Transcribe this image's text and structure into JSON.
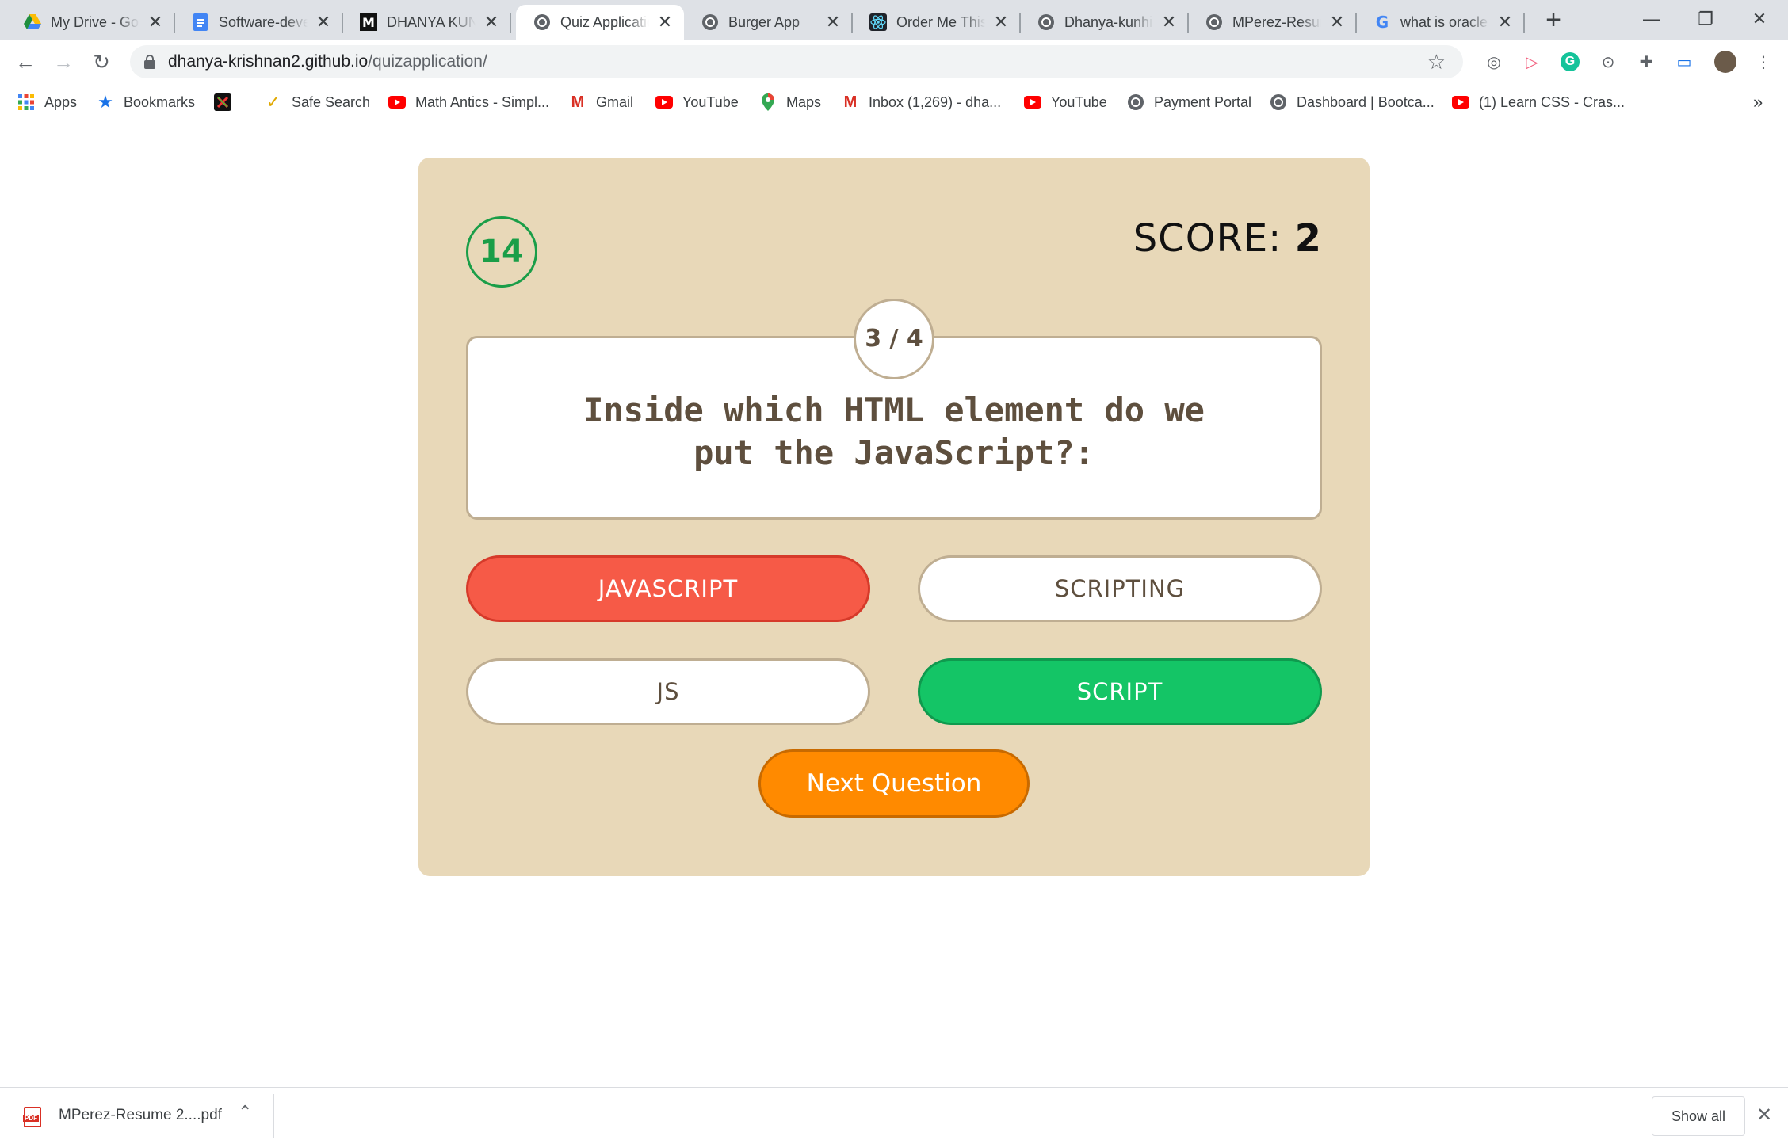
{
  "browser": {
    "tabs": [
      {
        "title": "My Drive - Google Drive",
        "favicon": "google-drive-icon"
      },
      {
        "title": "Software-developer",
        "favicon": "google-docs-icon"
      },
      {
        "title": "DHANYA KUNHI",
        "favicon": "m-logo-icon"
      },
      {
        "title": "Quiz Application",
        "favicon": "globe-icon",
        "active": true
      },
      {
        "title": "Burger App",
        "favicon": "globe-icon"
      },
      {
        "title": "Order Me This",
        "favicon": "react-icon"
      },
      {
        "title": "Dhanya-kunhi",
        "favicon": "globe-icon"
      },
      {
        "title": "MPerez-Resume",
        "favicon": "globe-icon"
      },
      {
        "title": "what is oracle",
        "favicon": "google-icon"
      }
    ],
    "url": {
      "host": "dhanya-krishnan2.github.io",
      "path": "/quizapplication/"
    },
    "bookmarks": [
      {
        "label": "Apps",
        "icon": "apps-grid-icon"
      },
      {
        "label": "Bookmarks",
        "icon": "star-icon"
      },
      {
        "label": "",
        "icon": "x-logo-icon"
      },
      {
        "label": "Safe Search",
        "icon": "check-icon"
      },
      {
        "label": "Math Antics - Simpl...",
        "icon": "youtube-icon"
      },
      {
        "label": "Gmail",
        "icon": "gmail-icon"
      },
      {
        "label": "YouTube",
        "icon": "youtube-icon"
      },
      {
        "label": "Maps",
        "icon": "maps-pin-icon"
      },
      {
        "label": "Inbox (1,269) - dha...",
        "icon": "gmail-icon"
      },
      {
        "label": "YouTube",
        "icon": "youtube-icon"
      },
      {
        "label": "Payment Portal",
        "icon": "globe-icon"
      },
      {
        "label": "Dashboard | Bootca...",
        "icon": "globe-icon"
      },
      {
        "label": "(1) Learn CSS - Cras...",
        "icon": "youtube-icon"
      }
    ],
    "more_bookmarks": "»"
  },
  "quiz": {
    "timer": "14",
    "score_label": "SCORE:",
    "score_value": "2",
    "counter": "3 / 4",
    "question": "Inside which HTML element do we put the JavaScript?:",
    "options": [
      {
        "label": "JAVASCRIPT",
        "state": "wrong"
      },
      {
        "label": "SCRIPTING",
        "state": "plain"
      },
      {
        "label": "JS",
        "state": "plain"
      },
      {
        "label": "SCRIPT",
        "state": "correct"
      }
    ],
    "next_label": "Next Question"
  },
  "downloads": {
    "file_name": "MPerez-Resume 2....pdf",
    "show_all": "Show all"
  },
  "colors": {
    "card_bg": "#e8d8b8",
    "wrong": "#f65a47",
    "correct": "#14c566",
    "next": "#ff8a00",
    "timer": "#1a9e48"
  }
}
